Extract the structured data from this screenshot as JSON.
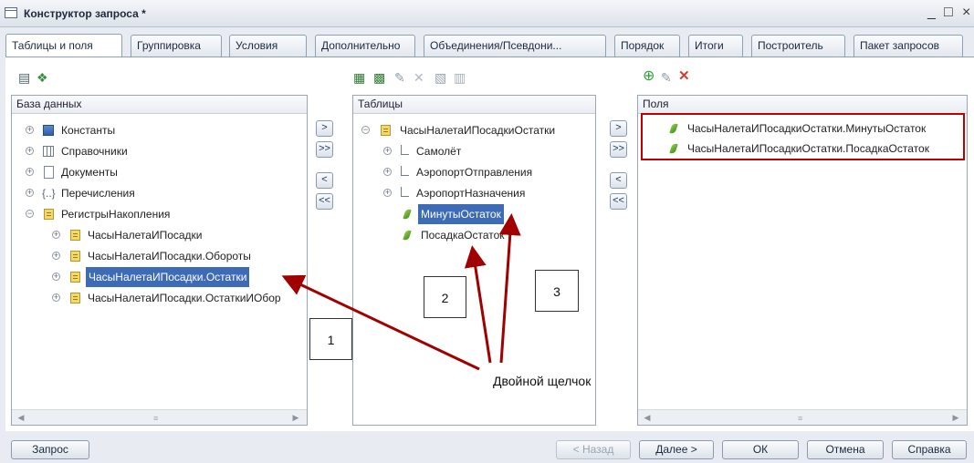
{
  "window": {
    "title": "Конструктор запроса *",
    "minimize": "_",
    "maximize": "□",
    "close": "×"
  },
  "tabs": [
    "Таблицы и поля",
    "Группировка",
    "Условия",
    "Дополнительно",
    "Объединения/Псевдони...",
    "Порядок",
    "Итоги",
    "Построитель",
    "Пакет запросов"
  ],
  "panels": {
    "database": {
      "header": "База данных",
      "items": [
        {
          "label": "Константы",
          "icon": "constants-icon"
        },
        {
          "label": "Справочники",
          "icon": "catalogs-icon"
        },
        {
          "label": "Документы",
          "icon": "documents-icon"
        },
        {
          "label": "Перечисления",
          "icon": "enumerations-icon"
        },
        {
          "label": "РегистрыНакопления",
          "icon": "register-icon",
          "expanded": true
        },
        {
          "label": "ЧасыНалетаИПосадки",
          "icon": "register-icon"
        },
        {
          "label": "ЧасыНалетаИПосадки.Обороты",
          "icon": "register-icon"
        },
        {
          "label": "ЧасыНалетаИПосадки.Остатки",
          "icon": "register-icon",
          "selected": true
        },
        {
          "label": "ЧасыНалетаИПосадки.ОстаткиИОбор",
          "icon": "register-icon"
        }
      ]
    },
    "tables": {
      "header": "Таблицы",
      "items": [
        {
          "label": "ЧасыНалетаИПосадкиОстатки",
          "icon": "register-icon",
          "expanded": true
        },
        {
          "label": "Самолёт",
          "icon": "link-icon"
        },
        {
          "label": "АэропортОтправления",
          "icon": "link-icon"
        },
        {
          "label": "АэропортНазначения",
          "icon": "link-icon"
        },
        {
          "label": "МинутыОстаток",
          "icon": "resource-icon",
          "selected": true
        },
        {
          "label": "ПосадкаОстаток",
          "icon": "resource-icon"
        }
      ]
    },
    "fields": {
      "header": "Поля",
      "items": [
        {
          "label": "ЧасыНалетаИПосадкиОстатки.МинутыОстаток",
          "icon": "resource-icon"
        },
        {
          "label": "ЧасыНалетаИПосадкиОстатки.ПосадкаОстаток",
          "icon": "resource-icon"
        }
      ]
    }
  },
  "transfer_buttons": {
    "move_one": ">",
    "move_all": ">>",
    "back_one": "<",
    "back_all": "<<"
  },
  "scrollbar": {
    "left": "◀",
    "right": "▶",
    "center": "≡"
  },
  "buttons": {
    "query": "Запрос",
    "back": "< Назад",
    "next": "Далее >",
    "ok": "ОК",
    "cancel": "Отмена",
    "help": "Справка"
  },
  "annotations": {
    "callouts": [
      "1",
      "2",
      "3"
    ],
    "label": "Двойной щелчок",
    "highlight_color": "#c00000",
    "arrow_color": "#a00000"
  }
}
